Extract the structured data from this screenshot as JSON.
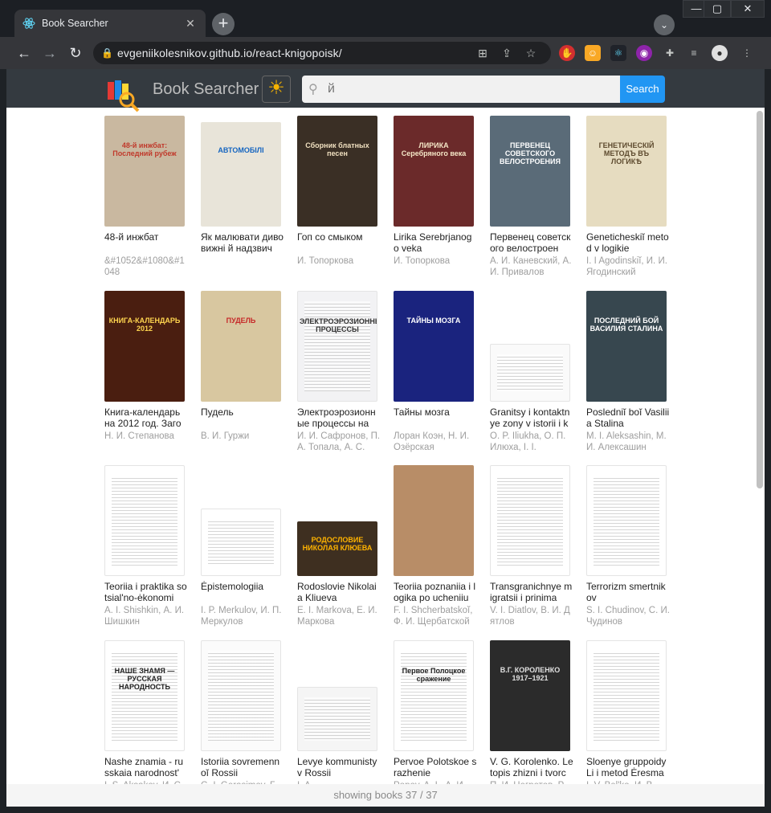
{
  "browser": {
    "tab_title": "Book Searcher",
    "tab_close": "✕",
    "new_tab": "+",
    "tab_search": "⌄",
    "url": "evgeniikolesnikov.github.io/react-knigopoisk/",
    "win_min": "—",
    "win_max": "▢",
    "win_close": "✕"
  },
  "app": {
    "brand": "Book Searcher",
    "search_value": "й",
    "search_button": "Search",
    "footer": "showing books 37 / 37"
  },
  "books": [
    {
      "title": "48-й инжбат",
      "authors": "&#1052&#1080&#1048",
      "cover": {
        "bg": "#c9b8a0",
        "fg": "#c0392b",
        "text": "48-й инжбат: Последний рубеж",
        "h": 138
      }
    },
    {
      "title": "Як малювати дивовижні й надзвич",
      "authors": "",
      "cover": {
        "bg": "#e8e4d9",
        "fg": "#1565c0",
        "text": "АВТОМОБІЛІ",
        "h": 130
      }
    },
    {
      "title": "Гоп со смыком",
      "authors": "И. Топоркова",
      "cover": {
        "bg": "#3a2f25",
        "fg": "#f0e0c0",
        "text": "Сборник блатных песен",
        "h": 138
      }
    },
    {
      "title": "Lirika Serebrjanogo veka",
      "authors": "И. Топоркова",
      "cover": {
        "bg": "#6b2a2a",
        "fg": "#f4e6c6",
        "text": "ЛИРИКА Серебряного века",
        "h": 138
      }
    },
    {
      "title": "Первенец советского велостроен",
      "authors": "А. И. Каневский, А. И. Привалов",
      "cover": {
        "bg": "#5a6b78",
        "fg": "#ffffff",
        "text": "ПЕРВЕНЕЦ СОВЕТСКОГО ВЕЛОСТРОЕНИЯ",
        "h": 138
      }
    },
    {
      "title": "Geneticheskiĭ metod v logikie",
      "authors": "I. I Agodinskiĭ, И. И. Ягодинский",
      "cover": {
        "bg": "#e6dcc0",
        "fg": "#5d4a2e",
        "text": "ГЕНЕТИЧЕСКІЙ МЕТОДЪ ВЪ ЛОГИКѢ",
        "h": 138
      }
    },
    {
      "title": "Книга-календарь на 2012 год. Заго",
      "authors": "Н. И. Степанова",
      "cover": {
        "bg": "#4a1e10",
        "fg": "#ffd54f",
        "text": "КНИГА-КАЛЕНДАРЬ 2012",
        "h": 138
      }
    },
    {
      "title": "Пудель",
      "authors": "В. И. Гуржи",
      "cover": {
        "bg": "#d8c7a0",
        "fg": "#c62828",
        "text": "ПУДЕЛЬ",
        "h": 138
      }
    },
    {
      "title": "Электроэрозионные процессы на",
      "authors": "И. И. Сафронов, П. А. Топала, А. С.",
      "cover": {
        "bg": "#f2f2f4",
        "fg": "#333",
        "text": "ЭЛЕКТРОЭРОЗИОННЫЕ ПРОЦЕССЫ",
        "h": 138
      }
    },
    {
      "title": "Тайны мозга",
      "authors": "Лоран Коэн, Н. И. Озёрская",
      "cover": {
        "bg": "#1a237e",
        "fg": "#ffffff",
        "text": "ТАЙНЫ МОЗГА",
        "h": 138
      }
    },
    {
      "title": "Granitsy i kontaktnye zony v istorii i k",
      "authors": "O. P. Iliukha, О. П. Илюха, I. I.",
      "cover": {
        "bg": "#fafafa",
        "fg": "#2e7d32",
        "text": "",
        "h": 72
      }
    },
    {
      "title": "Posledniĭ boĭ Vasiliia Stalina",
      "authors": "M. I. Aleksashin, М. И. Алексашин",
      "cover": {
        "bg": "#37474f",
        "fg": "#ffffff",
        "text": "ПОСЛЕДНИЙ БОЙ ВАСИЛИЯ СТАЛИНА",
        "h": 138
      }
    },
    {
      "title": "Teoriia i praktika sotsial'no-ėkonomi",
      "authors": "A. I. Shishkin, А. И. Шишкин",
      "cover": {
        "bg": "#ffffff",
        "fg": "#3949ab",
        "text": "",
        "h": 138
      }
    },
    {
      "title": "Ėpistemologiia",
      "authors": "I. P. Merkulov, И. П. Меркулов",
      "cover": {
        "bg": "#ffffff",
        "fg": "#333",
        "text": "",
        "h": 84
      }
    },
    {
      "title": "Rodoslovie Nikolaia Kliueva",
      "authors": "E. I. Markova, Е. И. Маркова",
      "cover": {
        "bg": "#3e2f20",
        "fg": "#ffb300",
        "text": "РОДОСЛОВИЕ НИКОЛАЯ КЛЮЕВА",
        "h": 68
      }
    },
    {
      "title": "Teoriia poznaniia i logika po ucheniiu",
      "authors": "F. I. Shcherbatskoĭ, Ф. И. Щербатской",
      "cover": {
        "bg": "#b88d67",
        "fg": "#4e342e",
        "text": "",
        "h": 138
      }
    },
    {
      "title": "Transgranichnye migratsii i prinima",
      "authors": "V. I. Diatlov, В. И. Дятлов",
      "cover": {
        "bg": "#ffffff",
        "fg": "#333",
        "text": "",
        "h": 138
      }
    },
    {
      "title": "Terrorizm smertnikov",
      "authors": "S. I. Chudinov, С. И. Чудинов",
      "cover": {
        "bg": "#ffffff",
        "fg": "#333",
        "text": "",
        "h": 138
      }
    },
    {
      "title": "Nashe znamia - russkaia narodnost'",
      "authors": "I. S. Aksakov, И. С.",
      "cover": {
        "bg": "#ffffff",
        "fg": "#222",
        "text": "НАШЕ ЗНАМЯ — РУССКАЯ НАРОДНОСТЬ",
        "h": 138
      }
    },
    {
      "title": "Istoriia sovremennoĭ Rossii",
      "authors": "G. I. Gerasimov, Г.",
      "cover": {
        "bg": "#fbfbfb",
        "fg": "#555",
        "text": "",
        "h": 138
      }
    },
    {
      "title": "Levye kommunisty v Rossii",
      "authors": "I. A.",
      "cover": {
        "bg": "#f5f5f5",
        "fg": "#333",
        "text": "",
        "h": 80
      }
    },
    {
      "title": "Pervoe Polotskoe srazhenie",
      "authors": "Popov, A. I., А. И.",
      "cover": {
        "bg": "#ffffff",
        "fg": "#222",
        "text": "Первое Полоцкое сражение",
        "h": 138
      }
    },
    {
      "title": "V. G. Korolenko. Letopis zhizni i tvorc",
      "authors": "П. И. Негретов, Р.",
      "cover": {
        "bg": "#2b2b2b",
        "fg": "#e0e0e0",
        "text": "В.Г. КОРОЛЕНКО 1917–1921",
        "h": 138
      }
    },
    {
      "title": "Sloenye gruppoidy Li i metod Ėresma",
      "authors": "I. V. Bel'ko, И. В.",
      "cover": {
        "bg": "#ffffff",
        "fg": "#333",
        "text": "",
        "h": 138
      }
    }
  ]
}
